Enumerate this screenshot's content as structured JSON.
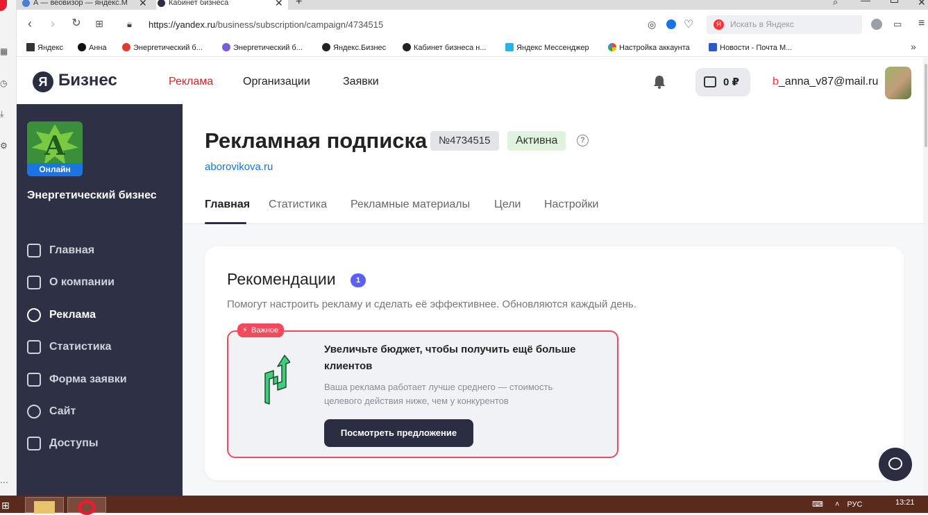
{
  "browser": {
    "tabs": [
      {
        "title": "А — веовизор — яндекс.М",
        "color": "#4a7fd4"
      },
      {
        "title": "Кабинет бизнеса",
        "color": "#2b2d42"
      }
    ],
    "url_host": "https://yandex.ru",
    "url_path": "/business/subscription/campaign/4734515",
    "search_placeholder": "Искать в Яндекс",
    "bookmarks": [
      {
        "label": "Яндекс",
        "icon": "page-icon"
      },
      {
        "label": "Анна",
        "icon": "plus-icon"
      },
      {
        "label": "Энергетический б...",
        "icon": "map-pin-icon"
      },
      {
        "label": "Энергетический б...",
        "icon": "globe-icon"
      },
      {
        "label": "Яндекс.Бизнес",
        "icon": "yandex-icon"
      },
      {
        "label": "Кабинет бизнеса н...",
        "icon": "yandex-icon"
      },
      {
        "label": "Яндекс Мессенджер",
        "icon": "play-icon"
      },
      {
        "label": "Настройка аккаунта",
        "icon": "google-icon"
      },
      {
        "label": "Новости - Почта М...",
        "icon": "mail-icon"
      }
    ]
  },
  "header": {
    "logo_letter": "Я",
    "logo_text": "Бизнес",
    "nav": [
      "Реклама",
      "Организации",
      "Заявки"
    ],
    "balance": "0 ₽",
    "email_first": "b",
    "email_rest": "_anna_v87@mail.ru"
  },
  "sidebar": {
    "org_logo_letter": "А",
    "online_label": "Онлайн",
    "org_name": "Энергетический бизнес",
    "items": [
      "Главная",
      "О компании",
      "Реклама",
      "Статистика",
      "Форма заявки",
      "Сайт",
      "Доступы"
    ],
    "active_index": 2
  },
  "page": {
    "title": "Рекламная подписка",
    "number": "№4734515",
    "status": "Активна",
    "help": "?",
    "site": "aborovikova.ru",
    "tabs": [
      "Главная",
      "Статистика",
      "Рекламные материалы",
      "Цели",
      "Настройки"
    ]
  },
  "recommendations": {
    "title": "Рекомендации",
    "count": "1",
    "subtitle": "Помогут настроить рекламу и сделать её эффективнее. Обновляются каждый день.",
    "card": {
      "tag": "Важное",
      "heading": "Увеличьте бюджет, чтобы получить ещё больше клиентов",
      "description": "Ваша реклама работает лучше среднего — стоимость целевого действия ниже, чем у конкурентов",
      "button": "Посмотреть предложение",
      "accent": "#f04a5c"
    }
  },
  "taskbar": {
    "lang": "РУС",
    "time": "13:21"
  }
}
